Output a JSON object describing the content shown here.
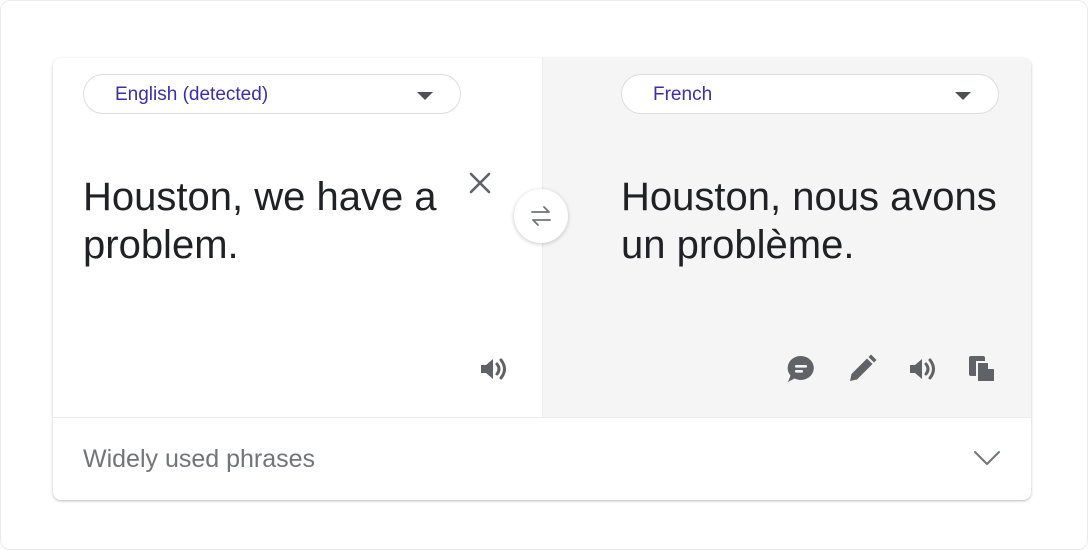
{
  "source": {
    "language": "English (detected)",
    "text": "Houston, we have a problem."
  },
  "target": {
    "language": "French",
    "text": "Houston, nous avons un problème."
  },
  "footer": {
    "label": "Widely used phrases"
  },
  "icons": {
    "dropdown": "caret-down-icon",
    "clear": "close-icon",
    "swap": "swap-arrows-icon",
    "listen": "speaker-icon",
    "feedback": "feedback-icon",
    "edit": "pencil-icon",
    "copy": "copy-icon",
    "expand": "chevron-down-icon"
  },
  "colors": {
    "language_label": "#3c2eaa",
    "icon": "#5f6368",
    "target_pane_background": "#f5f5f5"
  }
}
